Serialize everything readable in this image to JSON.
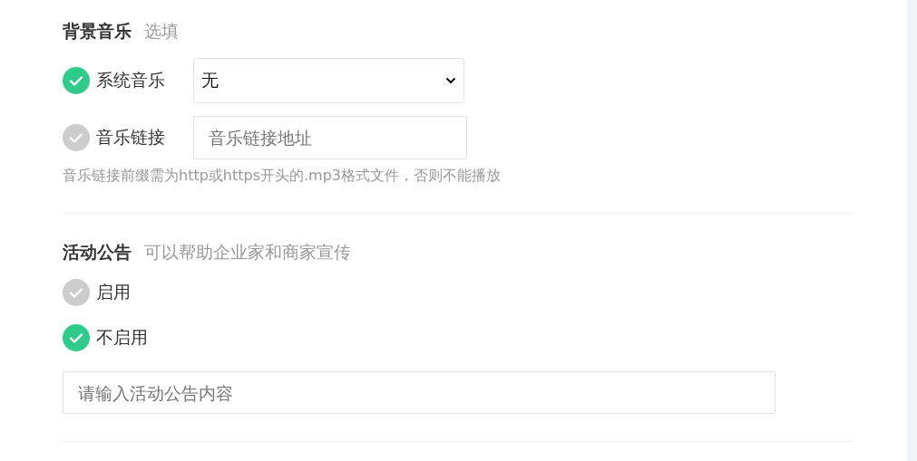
{
  "sections": [
    {
      "title": "背景音乐",
      "subtitle": "选填",
      "options": [
        {
          "label": "系统音乐",
          "selected": true,
          "kind": "select",
          "value": "无"
        },
        {
          "label": "音乐链接",
          "selected": false,
          "kind": "input",
          "placeholder": "音乐链接地址"
        }
      ],
      "hint": "音乐链接前缀需为http或https开头的.mp3格式文件，否则不能播放"
    },
    {
      "title": "活动公告",
      "subtitle": "可以帮助企业家和商家宣传",
      "options": [
        {
          "label": "启用",
          "selected": false,
          "kind": "plain"
        },
        {
          "label": "不启用",
          "selected": true,
          "kind": "plain"
        }
      ],
      "field": {
        "placeholder": "请输入活动公告内容"
      }
    }
  ]
}
